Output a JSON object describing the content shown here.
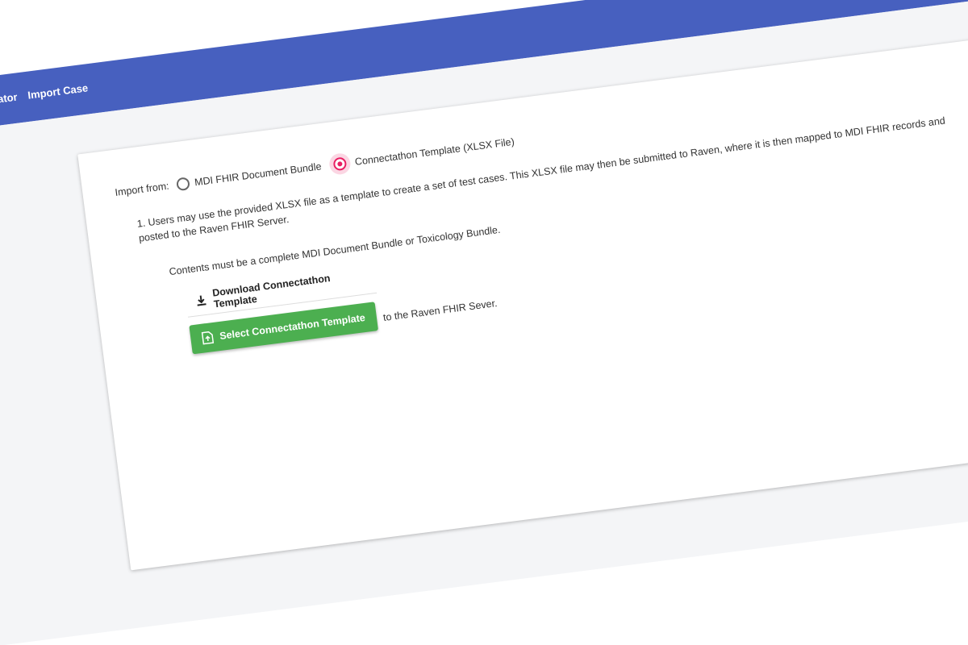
{
  "nav": {
    "validator_label": "Validator",
    "import_case_label": "Import Case"
  },
  "import": {
    "label": "Import from:",
    "options": [
      {
        "label": "MDI FHIR Document Bundle",
        "selected": false
      },
      {
        "label": "Connectathon Template (XLSX File)",
        "selected": true
      }
    ]
  },
  "instructions": {
    "step1": "1. Users may use the provided XLSX file as a template to create a set of test cases. This XLSX file may then be submitted to Raven, where it is then mapped to MDI FHIR records and posted to the Raven FHIR Server.",
    "contents_note": "Contents must be a complete MDI Document Bundle or Toxicology Bundle."
  },
  "actions": {
    "download_label": "Download Connectathon Template",
    "select_label": "Select Connectathon Template",
    "submit_note": "to the Raven FHIR Sever."
  },
  "colors": {
    "navbar": "#4760bf",
    "radio_selected": "#e91e63",
    "select_button": "#4caf50"
  },
  "icons": {
    "download": "download-icon",
    "file_upload": "file-upload-icon"
  }
}
